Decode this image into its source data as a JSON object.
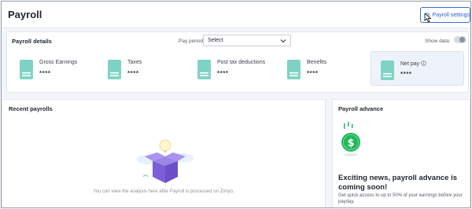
{
  "header": {
    "title": "Payroll",
    "settings_button": "Payroll settings"
  },
  "details": {
    "title": "Payroll details",
    "pay_period_label": "Pay period:",
    "pay_period_value": "Select",
    "show_data_label": "Show data:",
    "metrics": [
      {
        "label": "Gross Earnings",
        "value": "****"
      },
      {
        "label": "Taxes",
        "value": "****"
      },
      {
        "label": "Post tax deductions",
        "value": "****"
      },
      {
        "label": "Benefits",
        "value": "****"
      },
      {
        "label": "Net pay",
        "value": "****"
      }
    ]
  },
  "recent": {
    "title": "Recent payrolls",
    "empty_text": "You can view the analysis here after Payroll is processed on Zimyo."
  },
  "advance": {
    "title": "Payroll advance",
    "headline": "Exciting news, payroll advance is coming soon!",
    "description": "Get quick access to up to 50% of your earnings before your payday."
  },
  "colors": {
    "accent": "#3a6fd8",
    "metric_icon": "#7fd3c4",
    "box_purple": "#7b5fd6",
    "coin_green": "#21b85a"
  },
  "icons": {
    "settings": "gear-doc-icon",
    "select_caret": "chevron-down-icon",
    "metric": "payslip-icon",
    "info": "info-icon",
    "empty_state": "open-box-illustration",
    "advance": "dollar-coin-illustration"
  }
}
